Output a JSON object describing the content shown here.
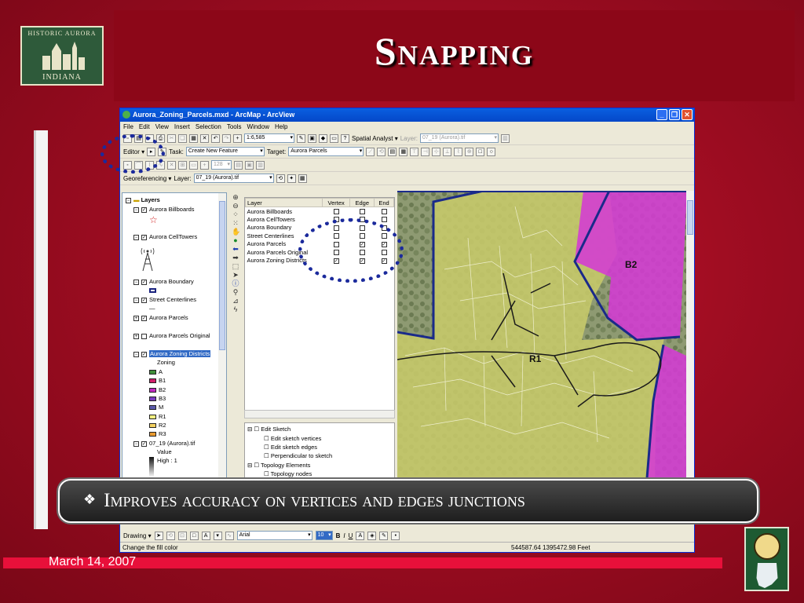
{
  "slide": {
    "title": "Snapping",
    "callout": "Improves accuracy on vertices and edges junctions",
    "callout_bullet": "❖",
    "date": "March 14, 2007",
    "logo": {
      "arc_text": "HISTORIC AURORA",
      "state_text": "INDIANA"
    }
  },
  "window": {
    "title": "Aurora_Zoning_Parcels.mxd - ArcMap - ArcView",
    "buttons": {
      "minimize": "_",
      "maximize": "❐",
      "close": "✕"
    }
  },
  "menu": [
    "File",
    "Edit",
    "View",
    "Insert",
    "Selection",
    "Tools",
    "Window",
    "Help"
  ],
  "toolbar1": {
    "scale": "1:6,585",
    "spatial_analyst": "Spatial Analyst ▾",
    "layer_label": "Layer:",
    "layer_value": "07_19 (Aurora).tif"
  },
  "editor_bar": {
    "editor": "Editor ▾",
    "task_label": "Task:",
    "task_value": "Create New Feature",
    "target_label": "Target:",
    "target_value": "Aurora Parcels"
  },
  "toolbar3": {
    "zoom_value": "128"
  },
  "georef_bar": {
    "georef": "Georeferencing ▾",
    "layer_label": "Layer:",
    "layer_value": "07_19 (Aurora).tif"
  },
  "toc": {
    "root": "Layers",
    "layers": [
      {
        "name": "Aurora Billboards",
        "checked": true
      },
      {
        "name": "Aurora CellTowers",
        "checked": true
      },
      {
        "name": "Aurora Boundary",
        "checked": true
      },
      {
        "name": "Street Centerlines",
        "checked": true
      },
      {
        "name": "Aurora Parcels",
        "checked": true
      },
      {
        "name": "Aurora Parcels Original",
        "checked": false
      },
      {
        "name": "Aurora Zoning Districts",
        "checked": true
      },
      {
        "name": "07_19 (Aurora).tif",
        "checked": true
      }
    ],
    "zoning_header": "Zoning",
    "zones": [
      {
        "name": "A",
        "color": "#3f8f3a"
      },
      {
        "name": "B1",
        "color": "#d01c6a"
      },
      {
        "name": "B2",
        "color": "#c028c0"
      },
      {
        "name": "B3",
        "color": "#7a3ac0"
      },
      {
        "name": "M",
        "color": "#5a5aaa"
      },
      {
        "name": "R1",
        "color": "#f2f080"
      },
      {
        "name": "R2",
        "color": "#f2d060"
      },
      {
        "name": "R3",
        "color": "#e89a30"
      }
    ],
    "raster_value": "Value",
    "raster_high": "High : 1"
  },
  "snapping": {
    "headers": [
      "Layer",
      "Vertex",
      "Edge",
      "End"
    ],
    "rows": [
      {
        "layer": "Aurora Billboards",
        "vertex": false,
        "edge": false,
        "end": false
      },
      {
        "layer": "Aurora CellTowers",
        "vertex": false,
        "edge": false,
        "end": false
      },
      {
        "layer": "Aurora Boundary",
        "vertex": false,
        "edge": false,
        "end": false
      },
      {
        "layer": "Street Centerlines",
        "vertex": false,
        "edge": false,
        "end": false
      },
      {
        "layer": "Aurora Parcels",
        "vertex": false,
        "edge": true,
        "end": true
      },
      {
        "layer": "Aurora Parcels Original",
        "vertex": false,
        "edge": false,
        "end": false
      },
      {
        "layer": "Aurora Zoning Districts",
        "vertex": true,
        "edge": true,
        "end": true
      }
    ],
    "tree": [
      "Edit Sketch",
      "Edit sketch vertices",
      "Edit sketch edges",
      "Perpendicular to sketch",
      "Topology Elements",
      "Topology nodes"
    ]
  },
  "map": {
    "label_b2": "B2",
    "label_r1": "R1"
  },
  "drawing": {
    "drawing": "Drawing ▾",
    "font": "Arial",
    "size": "10",
    "bold": "B",
    "italic": "I",
    "underline": "U"
  },
  "status": {
    "message": "Change the fill color",
    "coords": "544587.64  1395472.98 Feet"
  }
}
